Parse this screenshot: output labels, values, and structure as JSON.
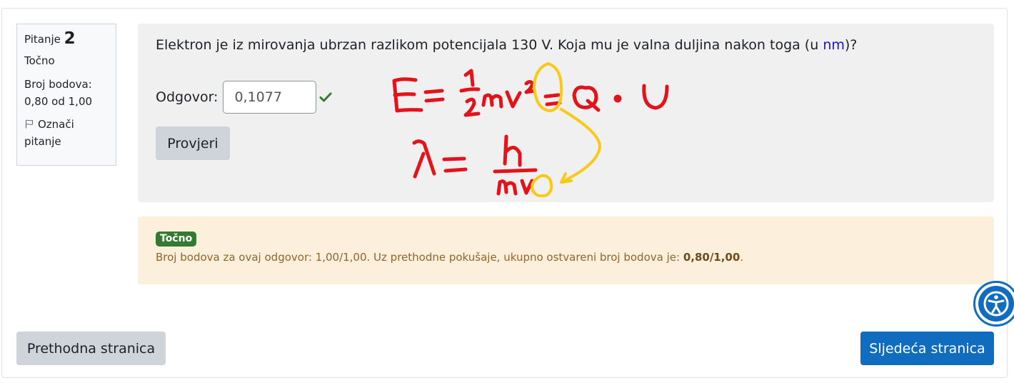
{
  "info": {
    "question_label": "Pitanje",
    "question_number": "2",
    "state": "Točno",
    "grade_line1": "Broj bodova:",
    "grade_line2": "0,80 od 1,00",
    "flag_label": "Označi pitanje",
    "flag_icon": "flag-outline-icon"
  },
  "question": {
    "text_before": "Elektron je iz mirovanja ubrzan razlikom potencijala 130 V. Koja mu je valna duljina nakon toga (u ",
    "unit": "nm",
    "text_after": ")?",
    "answer_label": "Odgovor:",
    "answer_value": "0,1077",
    "answer_correct_icon": "checkmark-icon",
    "check_button": "Provjeri"
  },
  "feedback": {
    "badge": "Točno",
    "text": "Broj bodova za ovaj odgovor: 1,00/1,00. Uz prethodne pokušaje, ukupno ostvareni broj bodova je: ",
    "total": "0,80/1,00",
    "end": "."
  },
  "navigation": {
    "prev_label": "Prethodna stranica",
    "next_label": "Sljedeća stranica"
  },
  "accessibility_icon": "accessibility-icon",
  "colors": {
    "primary": "#0f6cbf",
    "correct_badge": "#357a32",
    "feedback_bg": "#fcefdc",
    "annotation_red": "#e3131b",
    "annotation_yellow": "#f8c915"
  }
}
